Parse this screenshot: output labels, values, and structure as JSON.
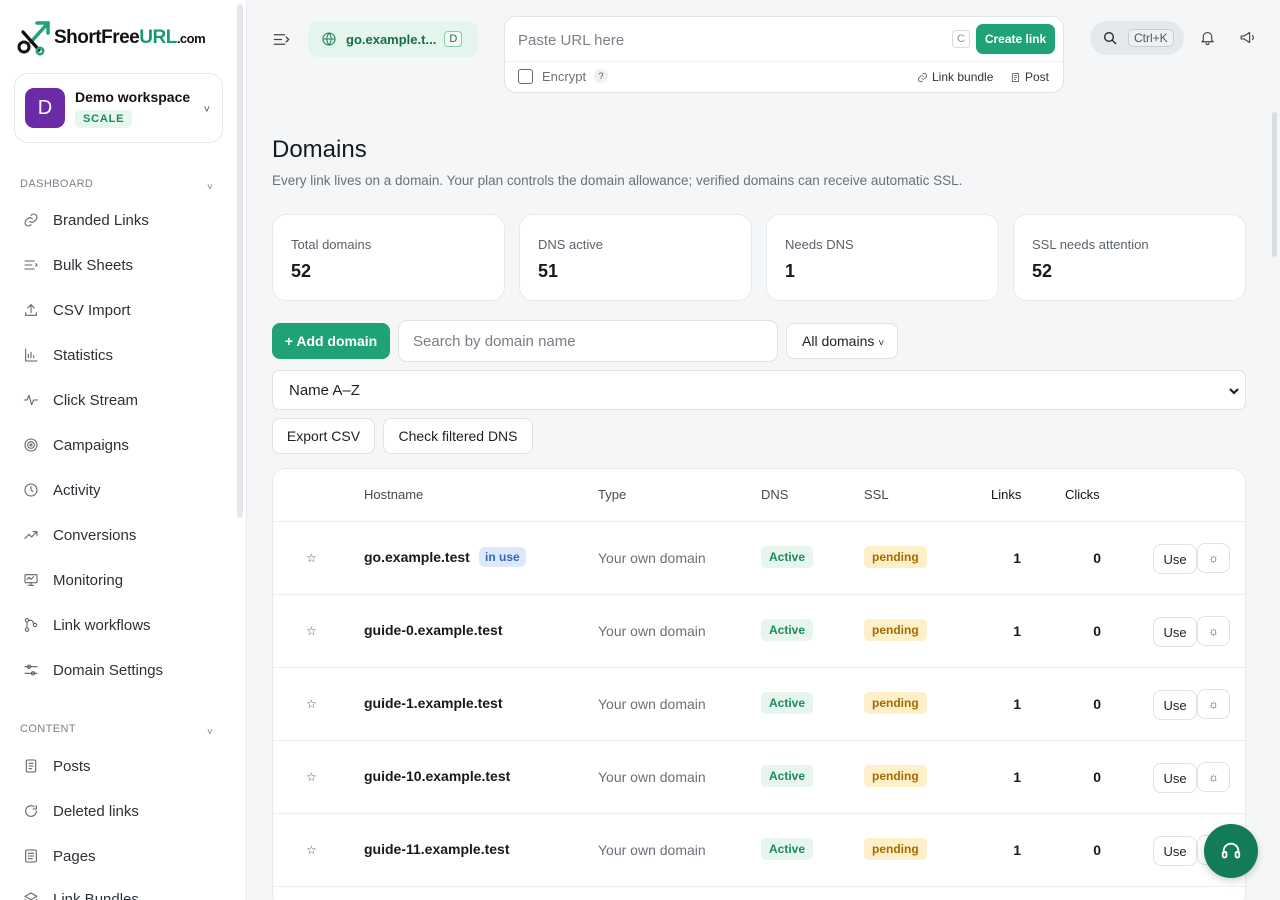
{
  "brand": {
    "name_main": "ShortFree",
    "name_accent": "URL",
    "name_suffix": ".com",
    "accent_color": "#1fa276"
  },
  "workspace": {
    "avatar_letter": "D",
    "name": "Demo workspace",
    "plan": "SCALE"
  },
  "sidebar": {
    "dashboard_title": "DASHBOARD",
    "content_title": "CONTENT",
    "dashboard_items": [
      {
        "label": "Branded Links",
        "icon": "link-icon"
      },
      {
        "label": "Bulk Sheets",
        "icon": "list-icon"
      },
      {
        "label": "CSV Import",
        "icon": "upload-icon"
      },
      {
        "label": "Statistics",
        "icon": "bar-chart-icon"
      },
      {
        "label": "Click Stream",
        "icon": "activity-icon"
      },
      {
        "label": "Campaigns",
        "icon": "target-icon"
      },
      {
        "label": "Activity",
        "icon": "clock-icon"
      },
      {
        "label": "Conversions",
        "icon": "trending-up-icon"
      },
      {
        "label": "Monitoring",
        "icon": "monitor-icon"
      },
      {
        "label": "Link workflows",
        "icon": "workflow-icon"
      },
      {
        "label": "Domain Settings",
        "icon": "sliders-icon"
      }
    ],
    "content_items": [
      {
        "label": "Posts",
        "icon": "document-icon"
      },
      {
        "label": "Deleted links",
        "icon": "refresh-icon"
      },
      {
        "label": "Pages",
        "icon": "page-icon"
      },
      {
        "label": "Link Bundles",
        "icon": "layers-icon"
      }
    ]
  },
  "topbar": {
    "current_domain": "go.example.t...",
    "domain_shortcut": "D",
    "url_placeholder": "Paste URL here",
    "url_shortcut": "C",
    "create_label": "Create link",
    "encrypt_label": "Encrypt",
    "encrypt_help": "?",
    "link_bundle_label": "Link bundle",
    "post_label": "Post",
    "search_shortcut": "Ctrl+K"
  },
  "page": {
    "title": "Domains",
    "subtitle": "Every link lives on a domain. Your plan controls the domain allowance; verified domains can receive automatic SSL."
  },
  "stats": [
    {
      "label": "Total domains",
      "value": "52"
    },
    {
      "label": "DNS active",
      "value": "51"
    },
    {
      "label": "Needs DNS",
      "value": "1"
    },
    {
      "label": "SSL needs attention",
      "value": "52"
    }
  ],
  "controls": {
    "add_label": "+ Add domain",
    "search_placeholder": "Search by domain name",
    "filter_label": "All domains",
    "sort_label": "Name A–Z",
    "export_label": "Export CSV",
    "check_dns_label": "Check filtered DNS"
  },
  "table": {
    "headers": {
      "hostname": "Hostname",
      "type": "Type",
      "dns": "DNS",
      "ssl": "SSL",
      "links": "Links",
      "clicks": "Clicks"
    },
    "rows": [
      {
        "star": "☆",
        "host": "go.example.test",
        "badge": "in use",
        "type": "Your own domain",
        "dns": "Active",
        "ssl": "pending",
        "links": "1",
        "clicks": "0",
        "use": "Use"
      },
      {
        "star": "☆",
        "host": "guide-0.example.test",
        "badge": "",
        "type": "Your own domain",
        "dns": "Active",
        "ssl": "pending",
        "links": "1",
        "clicks": "0",
        "use": "Use"
      },
      {
        "star": "☆",
        "host": "guide-1.example.test",
        "badge": "",
        "type": "Your own domain",
        "dns": "Active",
        "ssl": "pending",
        "links": "1",
        "clicks": "0",
        "use": "Use"
      },
      {
        "star": "☆",
        "host": "guide-10.example.test",
        "badge": "",
        "type": "Your own domain",
        "dns": "Active",
        "ssl": "pending",
        "links": "1",
        "clicks": "0",
        "use": "Use"
      },
      {
        "star": "☆",
        "host": "guide-11.example.test",
        "badge": "",
        "type": "Your own domain",
        "dns": "Active",
        "ssl": "pending",
        "links": "1",
        "clicks": "0",
        "use": "Use"
      }
    ]
  }
}
